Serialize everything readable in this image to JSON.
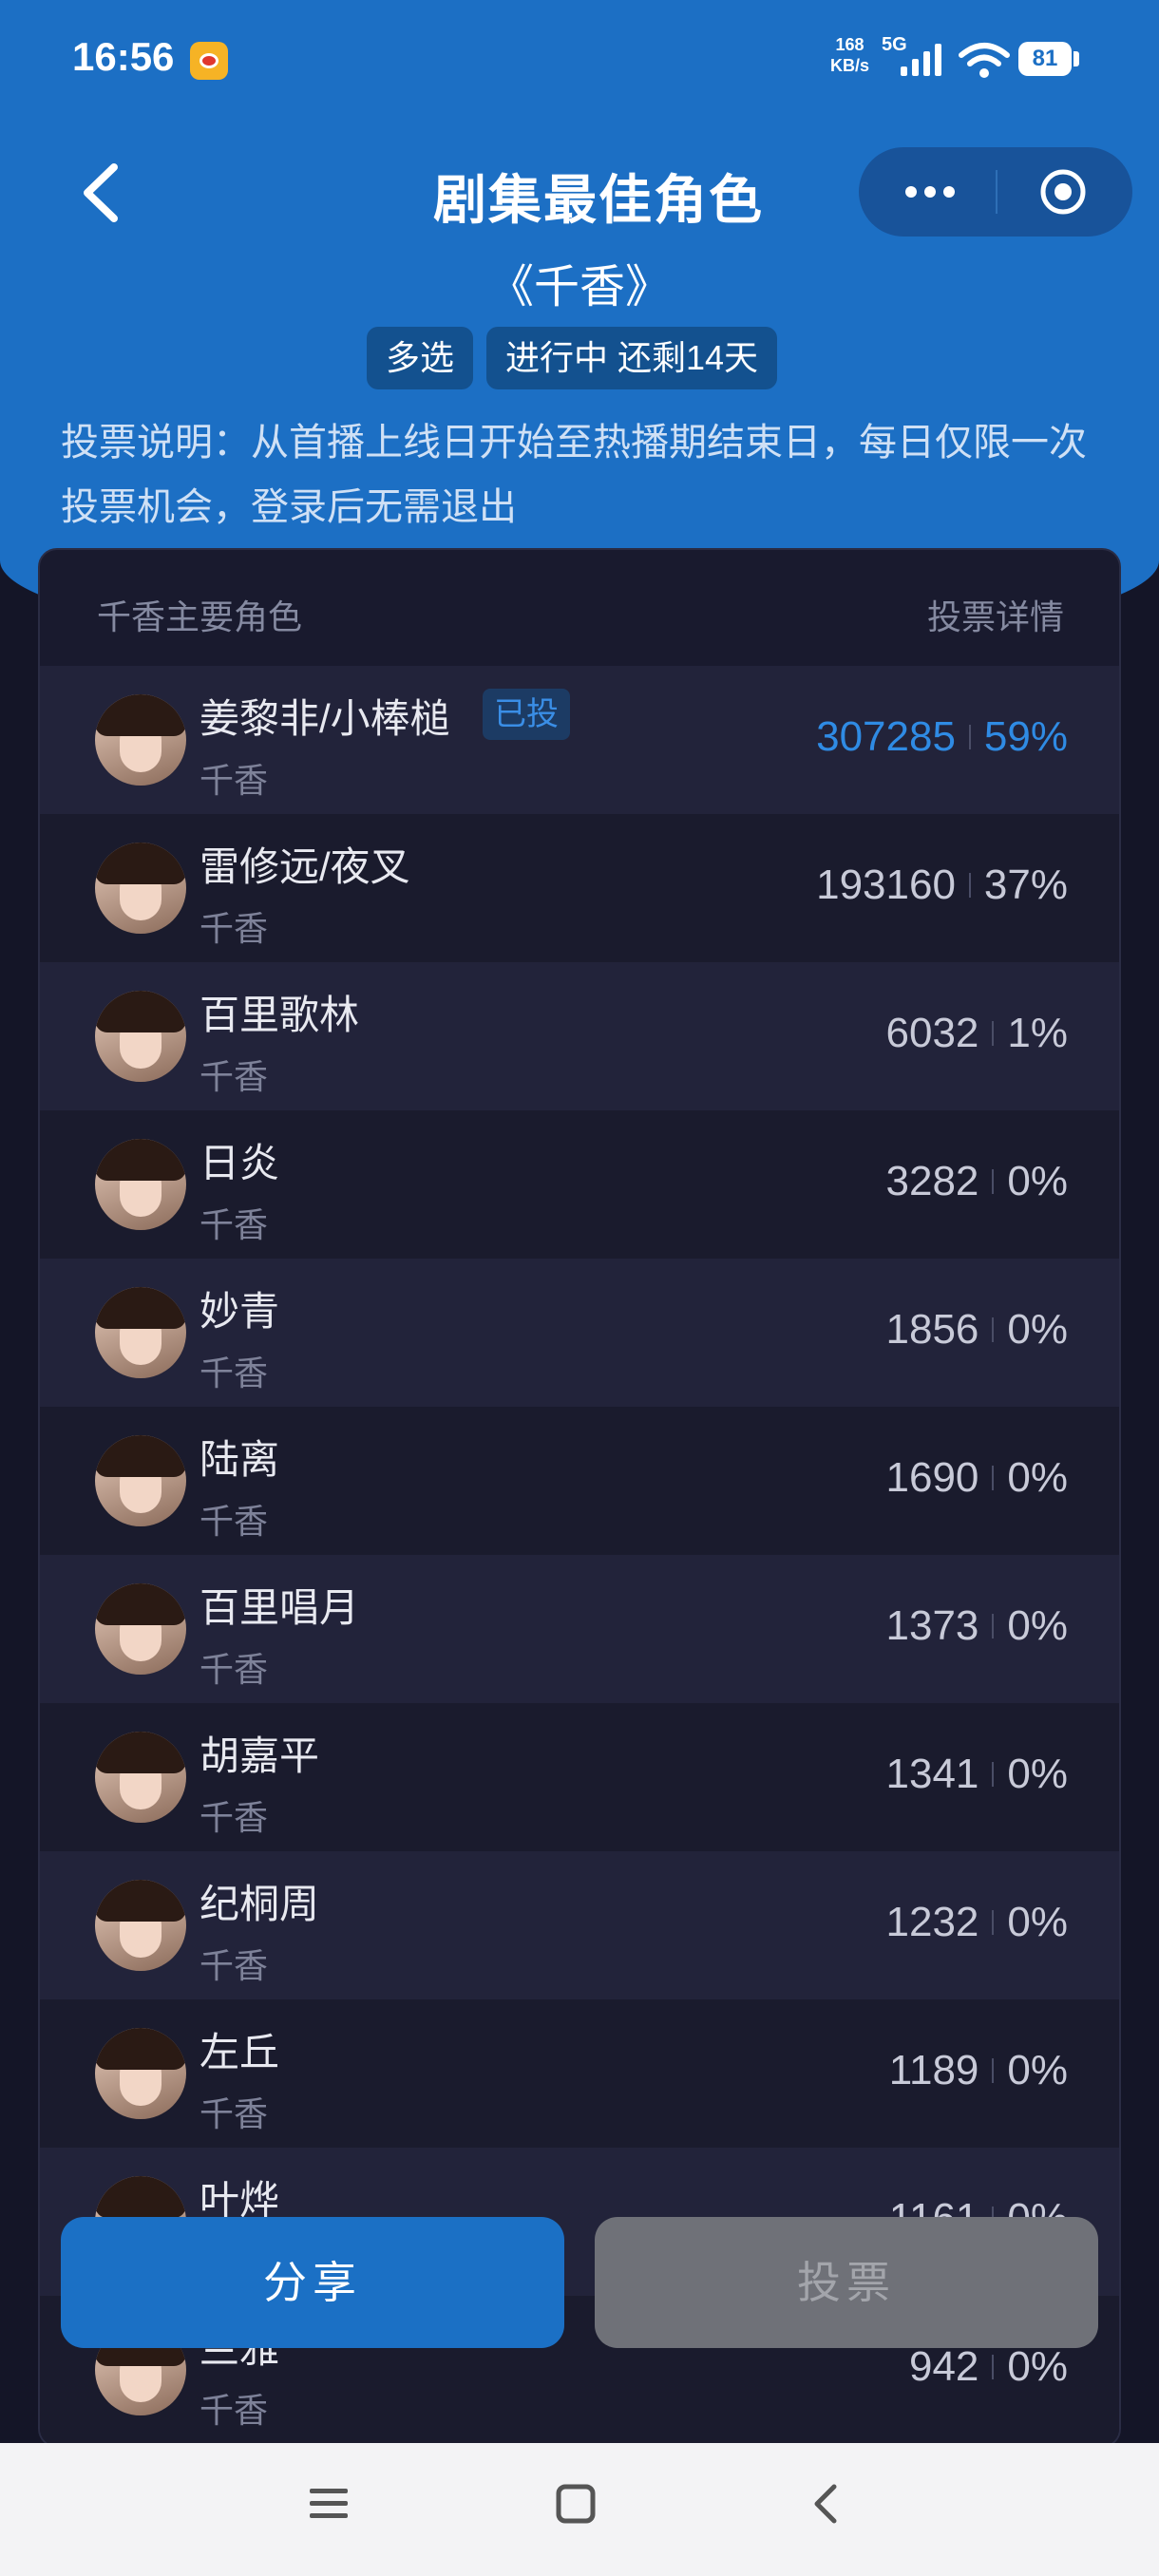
{
  "status_bar": {
    "time": "16:56",
    "speed_value": "168",
    "speed_unit": "KB/s",
    "network": "5G",
    "battery": "81"
  },
  "header": {
    "title": "剧集最佳角色",
    "subtitle": "《千香》",
    "badge_mode": "多选",
    "badge_status": "进行中 还剩14天",
    "description": "投票说明：从首播上线日开始至热播期结束日，每日仅限一次投票机会，登录后无需退出"
  },
  "panel": {
    "left_header": "千香主要角色",
    "right_header": "投票详情",
    "voted_label": "已投",
    "rows": [
      {
        "name": "姜黎非/小棒槌",
        "show": "千香",
        "votes": "307285",
        "percent": "59%",
        "voted": true
      },
      {
        "name": "雷修远/夜叉",
        "show": "千香",
        "votes": "193160",
        "percent": "37%",
        "voted": false
      },
      {
        "name": "百里歌林",
        "show": "千香",
        "votes": "6032",
        "percent": "1%",
        "voted": false
      },
      {
        "name": "日炎",
        "show": "千香",
        "votes": "3282",
        "percent": "0%",
        "voted": false
      },
      {
        "name": "妙青",
        "show": "千香",
        "votes": "1856",
        "percent": "0%",
        "voted": false
      },
      {
        "name": "陆离",
        "show": "千香",
        "votes": "1690",
        "percent": "0%",
        "voted": false
      },
      {
        "name": "百里唱月",
        "show": "千香",
        "votes": "1373",
        "percent": "0%",
        "voted": false
      },
      {
        "name": "胡嘉平",
        "show": "千香",
        "votes": "1341",
        "percent": "0%",
        "voted": false
      },
      {
        "name": "纪桐周",
        "show": "千香",
        "votes": "1232",
        "percent": "0%",
        "voted": false
      },
      {
        "name": "左丘",
        "show": "千香",
        "votes": "1189",
        "percent": "0%",
        "voted": false
      },
      {
        "name": "叶烨",
        "show": "千香",
        "votes": "1161",
        "percent": "0%",
        "voted": false
      },
      {
        "name": "兰雅",
        "show": "千香",
        "votes": "942",
        "percent": "0%",
        "voted": false
      }
    ]
  },
  "buttons": {
    "share": "分享",
    "vote": "投票"
  },
  "colors": {
    "brand_blue": "#1c6fc4",
    "highlight": "#2f8be4",
    "background": "#141527"
  }
}
